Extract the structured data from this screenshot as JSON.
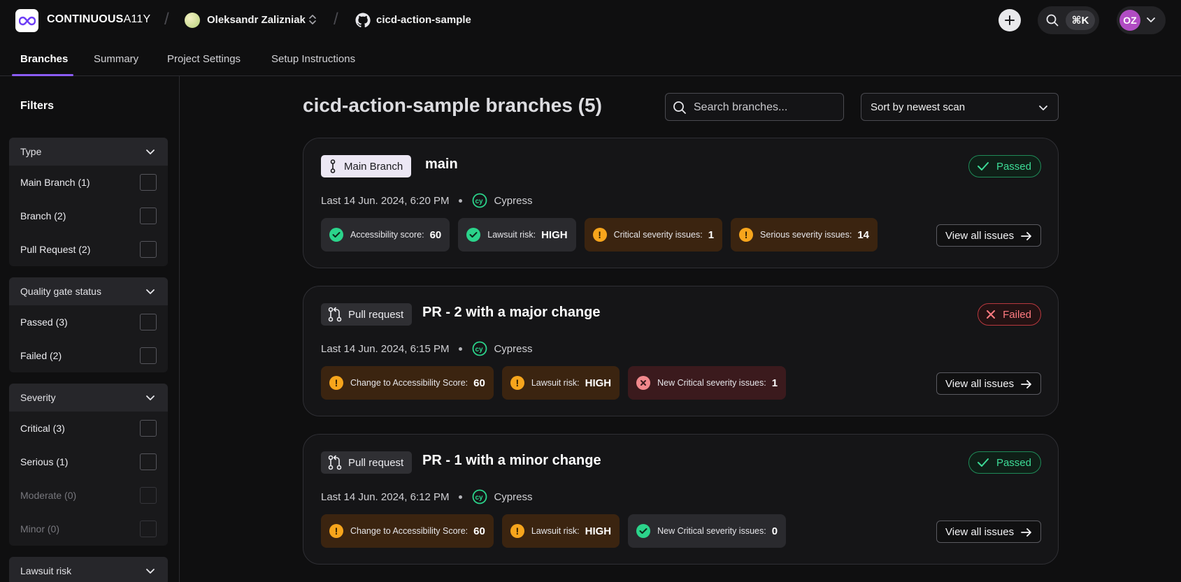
{
  "brand": {
    "name_bold": "CONTINUOUS",
    "name_thin": "A11Y"
  },
  "header": {
    "org_name": "Oleksandr Zalizniak",
    "repo_name": "cicd-action-sample",
    "shortcut_label": "⌘K",
    "user_initials": "OZ"
  },
  "tabs": [
    "Branches",
    "Summary",
    "Project Settings",
    "Setup Instructions"
  ],
  "sidebar": {
    "title": "Filters",
    "groups": [
      {
        "title": "Type",
        "options": [
          {
            "label": "Main Branch (1)",
            "disabled": false
          },
          {
            "label": "Branch (2)",
            "disabled": false
          },
          {
            "label": "Pull Request (2)",
            "disabled": false
          }
        ]
      },
      {
        "title": "Quality gate status",
        "options": [
          {
            "label": "Passed (3)",
            "disabled": false
          },
          {
            "label": "Failed (2)",
            "disabled": false
          }
        ]
      },
      {
        "title": "Severity",
        "options": [
          {
            "label": "Critical (3)",
            "disabled": false
          },
          {
            "label": "Serious (1)",
            "disabled": false
          },
          {
            "label": "Moderate (0)",
            "disabled": true
          },
          {
            "label": "Minor (0)",
            "disabled": true
          }
        ]
      },
      {
        "title": "Lawsuit risk",
        "options": []
      }
    ]
  },
  "main": {
    "title": "cicd-action-sample branches (5)",
    "search_placeholder": "Search branches...",
    "sort_label": "Sort by newest scan",
    "view_all_label": "View all issues",
    "cards": [
      {
        "type_label": "Main Branch",
        "name": "main",
        "status": "Passed",
        "last_scan": "Last 14 Jun. 2024, 6:20 PM",
        "framework": "Cypress",
        "chips": [
          {
            "label": "Accessibility score:",
            "value": "60",
            "tone": "ok"
          },
          {
            "label": "Lawsuit risk:",
            "value": "HIGH",
            "tone": "ok"
          },
          {
            "label": "Critical severity issues:",
            "value": "1",
            "tone": "warn"
          },
          {
            "label": "Serious severity issues:",
            "value": "14",
            "tone": "warn"
          }
        ]
      },
      {
        "type_label": "Pull request",
        "name": "PR - 2 with a major change",
        "status": "Failed",
        "last_scan": "Last 14 Jun. 2024, 6:15 PM",
        "framework": "Cypress",
        "chips": [
          {
            "label": "Change to Accessibility Score:",
            "value": "60",
            "tone": "warn"
          },
          {
            "label": "Lawsuit risk:",
            "value": "HIGH",
            "tone": "warn"
          },
          {
            "label": "New Critical severity issues:",
            "value": "1",
            "tone": "err"
          }
        ]
      },
      {
        "type_label": "Pull request",
        "name": "PR - 1 with a minor change",
        "status": "Passed",
        "last_scan": "Last 14 Jun. 2024, 6:12 PM",
        "framework": "Cypress",
        "chips": [
          {
            "label": "Change to Accessibility Score:",
            "value": "60",
            "tone": "warn"
          },
          {
            "label": "Lawsuit risk:",
            "value": "HIGH",
            "tone": "warn"
          },
          {
            "label": "New Critical severity issues:",
            "value": "0",
            "tone": "ok"
          }
        ]
      }
    ]
  },
  "colors": {
    "accent": "#8b5cf6",
    "passed": "#3ddc97",
    "failed": "#ff7b80",
    "warning": "#f7a51c"
  }
}
